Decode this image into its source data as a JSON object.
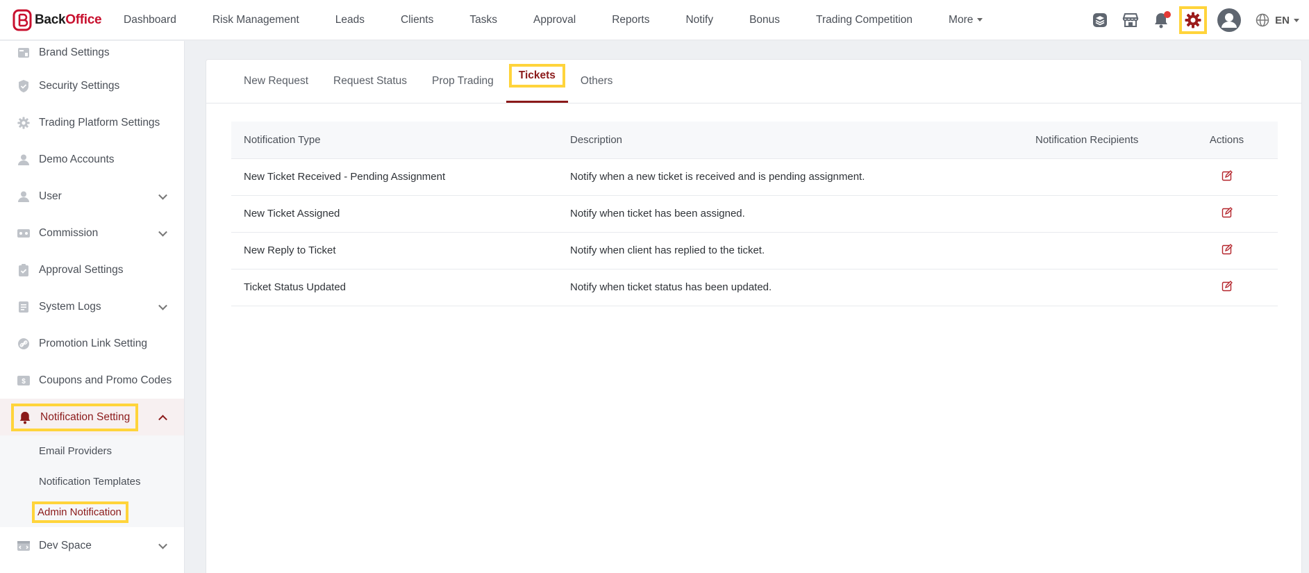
{
  "brand": {
    "part1": "Back",
    "part2": "Office"
  },
  "nav": {
    "items": [
      "Dashboard",
      "Risk Management",
      "Leads",
      "Clients",
      "Tasks",
      "Approval",
      "Reports",
      "Notify",
      "Bonus",
      "Trading Competition"
    ],
    "more": "More"
  },
  "top_icons": [
    "layers-icon",
    "store-icon",
    "bell-icon",
    "gear-icon",
    "avatar",
    "globe-icon"
  ],
  "lang": "EN",
  "sidebar": {
    "items": [
      {
        "label": "Brand Settings",
        "icon": "brand-settings-icon"
      },
      {
        "label": "Security Settings",
        "icon": "shield-icon"
      },
      {
        "label": "Trading Platform Settings",
        "icon": "gear-icon"
      },
      {
        "label": "Demo Accounts",
        "icon": "user-icon"
      },
      {
        "label": "User",
        "icon": "user-icon"
      },
      {
        "label": "Commission",
        "icon": "commission-icon"
      },
      {
        "label": "Approval Settings",
        "icon": "clipboard-check-icon"
      },
      {
        "label": "System Logs",
        "icon": "document-icon"
      },
      {
        "label": "Promotion Link Setting",
        "icon": "link-icon"
      },
      {
        "label": "Coupons and Promo Codes",
        "icon": "coupon-icon"
      },
      {
        "label": "Notification Setting",
        "icon": "bell-icon"
      },
      {
        "label": "Dev Space",
        "icon": "code-icon"
      }
    ],
    "notification_sub": [
      "Email Providers",
      "Notification Templates",
      "Admin Notification"
    ]
  },
  "tabs": [
    "New Request",
    "Request Status",
    "Prop Trading",
    "Tickets",
    "Others"
  ],
  "active_tab": "Tickets",
  "table": {
    "headers": [
      "Notification Type",
      "Description",
      "Notification Recipients",
      "Actions"
    ],
    "rows": [
      {
        "type": "New Ticket Received - Pending Assignment",
        "description": "Notify when a new ticket is received and is pending assignment.",
        "recipients": ""
      },
      {
        "type": "New Ticket Assigned",
        "description": "Notify when ticket has been assigned.",
        "recipients": ""
      },
      {
        "type": "New Reply to Ticket",
        "description": "Notify when client has replied to the ticket.",
        "recipients": ""
      },
      {
        "type": "Ticket Status Updated",
        "description": "Notify when ticket status has been updated.",
        "recipients": ""
      }
    ]
  },
  "colors": {
    "accent": "#8b1a1a",
    "highlight": "#ffd43b",
    "brand_red": "#c8102e",
    "notification_dot": "#e53935"
  }
}
